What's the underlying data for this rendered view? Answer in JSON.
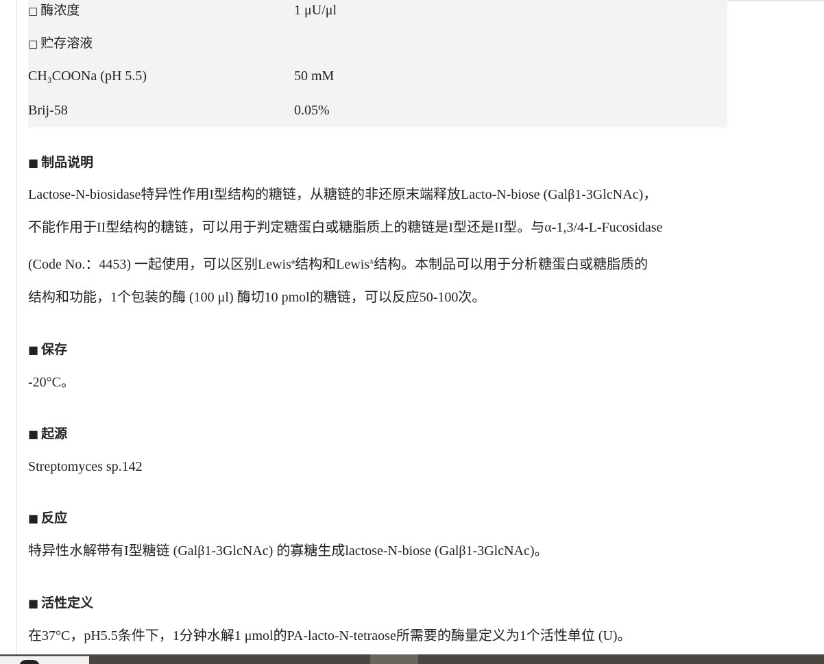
{
  "spec": {
    "rows": [
      {
        "label": "酶浓度",
        "value": "1 μU/μl",
        "bullet": "□"
      },
      {
        "label": "贮存溶液",
        "value": "",
        "bullet": "□"
      },
      {
        "label": "CH₃COONa (pH 5.5)",
        "value": "50 mM",
        "bullet": ""
      },
      {
        "label": "Brij-58",
        "value": "0.05%",
        "bullet": ""
      }
    ]
  },
  "sections": {
    "description": {
      "title": "制品说明",
      "line1": "Lactose-N-biosidase特异性作用I型结构的糖链，从糖链的非还原末端释放Lacto-N-biose (Galβ1-3GlcNAc)，",
      "line2": "不能作用于II型结构的糖链，可以用于判定糖蛋白或糖脂质上的糖链是I型还是II型。与α-1,3/4-L-Fucosidase",
      "line3_a": "(Code No.：4453) 一起使用，可以区别Lewis",
      "line3_sup_a": "a",
      "line3_b": "结构和Lewis",
      "line3_sup_x": "x",
      "line3_c": "结构。本制品可以用于分析糖蛋白或糖脂质的",
      "line4": "结构和功能，1个包装的酶 (100 μl) 酶切10 pmol的糖链，可以反应50-100次。"
    },
    "storage": {
      "title": "保存",
      "text": "-20°C。"
    },
    "origin": {
      "title": "起源",
      "text": "Streptomyces sp.142"
    },
    "reaction": {
      "title": "反应",
      "text": "特异性水解带有I型糖链 (Galβ1-3GlcNAc) 的寡糖生成lactose-N-biose (Galβ1-3GlcNAc)。"
    },
    "activity": {
      "title": "活性定义",
      "text": "在37°C，pH5.5条件下，1分钟水解1 μmol的PA-lacto-N-tetraose所需要的酶量定义为1个活性单位 (U)。"
    }
  },
  "heading_bullet": "■"
}
